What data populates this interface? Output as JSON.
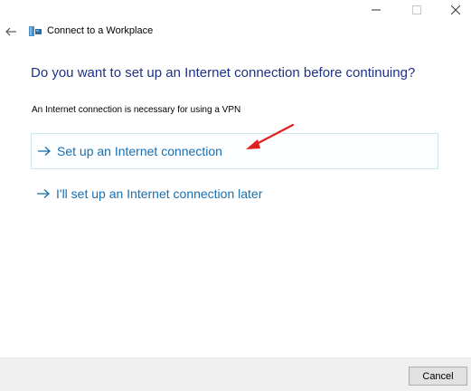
{
  "window": {
    "title": "Connect to a Workplace"
  },
  "main": {
    "question": "Do you want to set up an Internet connection before continuing?",
    "info": "An Internet connection is necessary for using a VPN",
    "options": [
      {
        "label": "Set up an Internet connection",
        "icon": "arrow-right-icon",
        "selected": true
      },
      {
        "label": "I'll set up an Internet connection later",
        "icon": "arrow-right-icon",
        "selected": false
      }
    ]
  },
  "footer": {
    "cancel_label": "Cancel"
  },
  "colors": {
    "heading": "#1e3287",
    "link": "#1a6fae",
    "annotation_arrow": "#e02020",
    "footer_bg": "#f0f0f0"
  },
  "icons": {
    "back": "back-arrow-icon",
    "app": "network-workplace-icon",
    "minimize": "minimize-icon",
    "maximize": "maximize-icon",
    "close": "close-icon"
  }
}
